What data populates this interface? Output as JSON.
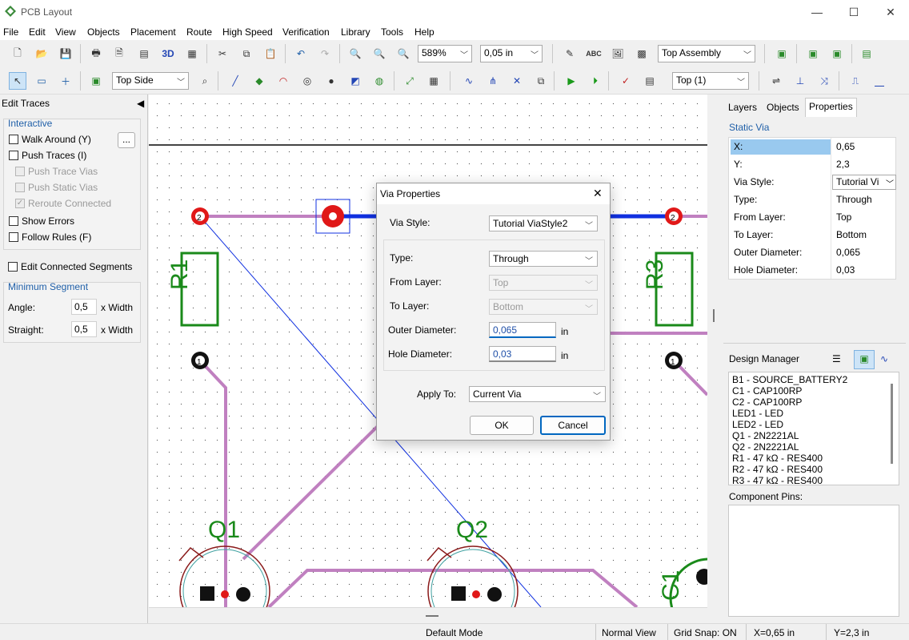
{
  "window": {
    "title": "PCB Layout",
    "minimize": "—",
    "maximize": "☐",
    "close": "✕"
  },
  "menu": [
    "File",
    "Edit",
    "View",
    "Objects",
    "Placement",
    "Route",
    "High Speed",
    "Verification",
    "Library",
    "Tools",
    "Help"
  ],
  "toolbar": {
    "zoom_value": "589%",
    "grid_value": "0,05 in",
    "assembly_value": "Top Assembly",
    "side_value": "Top Side",
    "layer_value": "Top (1)",
    "label_3d": "3D",
    "spell_label": "ABC"
  },
  "left_panel": {
    "title": "Edit Traces",
    "interactive_title": "Interactive",
    "walk_around": "Walk Around (Y)",
    "more_button": "...",
    "push_traces": "Push Traces (I)",
    "push_trace_vias": "Push Trace Vias",
    "push_static_vias": "Push Static Vias",
    "reroute_connected": "Reroute Connected",
    "show_errors": "Show Errors",
    "follow_rules": "Follow Rules (F)",
    "edit_connected": "Edit Connected Segments",
    "min_segment_title": "Minimum Segment",
    "angle_label": "Angle:",
    "angle_value": "0,5",
    "angle_unit": "x Width",
    "straight_label": "Straight:",
    "straight_value": "0,5",
    "straight_unit": "x Width"
  },
  "canvas": {
    "pad_label_left": "2",
    "pad_label_right": "2",
    "pad_label_bl": "1",
    "pad_label_br": "1",
    "r1": "R1",
    "r3": "R3",
    "q1": "Q1",
    "q2": "Q2",
    "c1": "C1",
    "colors": {
      "trace": "#c080c0",
      "via_red": "#e01818",
      "silk": "#1a8a1a",
      "blue_trace": "#1030e0"
    }
  },
  "right_panel": {
    "tabs": [
      "Layers",
      "Objects",
      "Properties"
    ],
    "section": "Static Via",
    "properties": [
      {
        "key": "X:",
        "value": "0,65"
      },
      {
        "key": "Y:",
        "value": "2,3"
      },
      {
        "key": "Via Style:",
        "value": "Tutorial Vi"
      },
      {
        "key": "Type:",
        "value": "Through"
      },
      {
        "key": "From Layer:",
        "value": "Top"
      },
      {
        "key": "To Layer:",
        "value": "Bottom"
      },
      {
        "key": "Outer Diameter:",
        "value": "0,065"
      },
      {
        "key": "Hole Diameter:",
        "value": "0,03"
      }
    ],
    "design_manager_title": "Design Manager",
    "components": [
      "B1 - SOURCE_BATTERY2",
      "C1 - CAP100RP",
      "C2 - CAP100RP",
      "LED1 - LED",
      "LED2 - LED",
      "Q1 - 2N2221AL",
      "Q2 - 2N2221AL",
      "R1 - 47 kΩ - RES400",
      "R2 - 47 kΩ - RES400",
      "R3 - 47 kΩ - RES400"
    ],
    "component_pins_title": "Component Pins:"
  },
  "status": {
    "mode": "Default Mode",
    "view": "Normal View",
    "snap": "Grid Snap: ON",
    "x": "X=0,65 in",
    "y": "Y=2,3 in"
  },
  "dialog": {
    "title": "Via Properties",
    "via_style_label": "Via Style:",
    "via_style_value": "Tutorial ViaStyle2",
    "type_label": "Type:",
    "type_value": "Through",
    "from_label": "From Layer:",
    "from_value": "Top",
    "to_label": "To Layer:",
    "to_value": "Bottom",
    "outer_label": "Outer Diameter:",
    "outer_value": "0,065",
    "outer_unit": "in",
    "hole_label": "Hole Diameter:",
    "hole_value": "0,03",
    "hole_unit": "in",
    "apply_label": "Apply To:",
    "apply_value": "Current Via",
    "ok": "OK",
    "cancel": "Cancel"
  }
}
